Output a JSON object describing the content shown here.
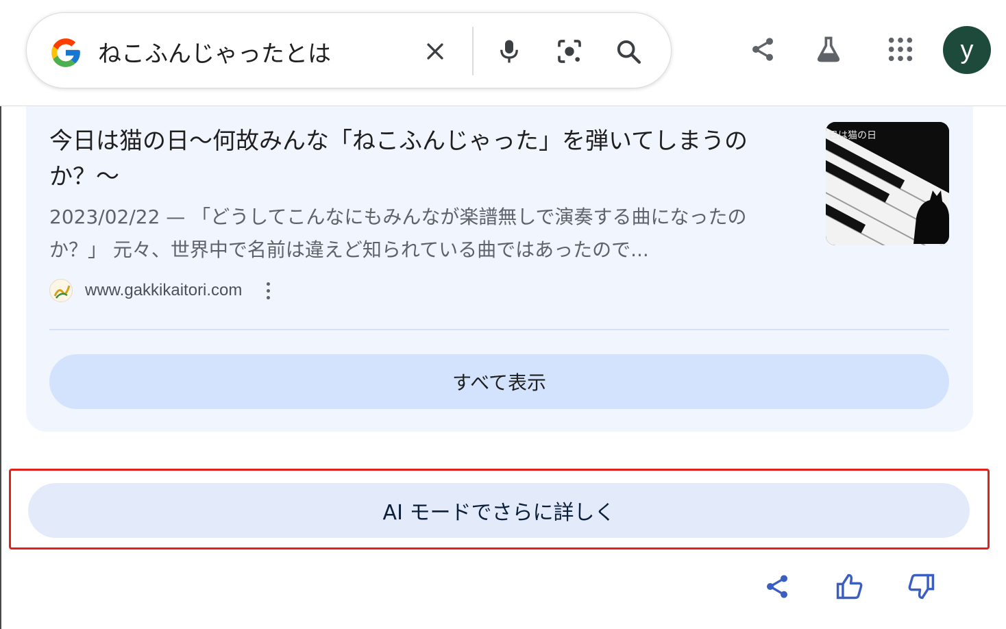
{
  "search": {
    "query": "ねこふんじゃったとは"
  },
  "header": {
    "avatar_letter": "y",
    "icons": [
      "share-icon",
      "labs-flask-icon",
      "apps-grid-icon"
    ]
  },
  "search_box_icons": [
    "clear-icon",
    "microphone-icon",
    "lens-camera-icon",
    "search-icon"
  ],
  "result": {
    "title": "今日は猫の日〜何故みんな「ねこふんじゃった」を弾いてしまうのか？〜",
    "date": "2023/02/22",
    "separator": " — ",
    "snippet": "「どうしてこんなにもみんなが楽譜無しで演奏する曲になったのか？」 元々、世界中で名前は違えど知られている曲ではあったので...",
    "source_url": "www.gakkikaitori.com",
    "thumbnail_text": "日は猫の日"
  },
  "show_all_label": "すべて表示",
  "ai_mode_label": "AI モードでさらに詳しく",
  "feedback_icons": [
    "share-icon",
    "thumbs-up-icon",
    "thumbs-down-icon"
  ],
  "colors": {
    "card_bg": "#f0f5fe",
    "button_bg": "#d3e3fd",
    "highlight": "#e0201a",
    "feedback_blue": "#3b5fc0",
    "avatar_bg": "#1e4a3c"
  }
}
